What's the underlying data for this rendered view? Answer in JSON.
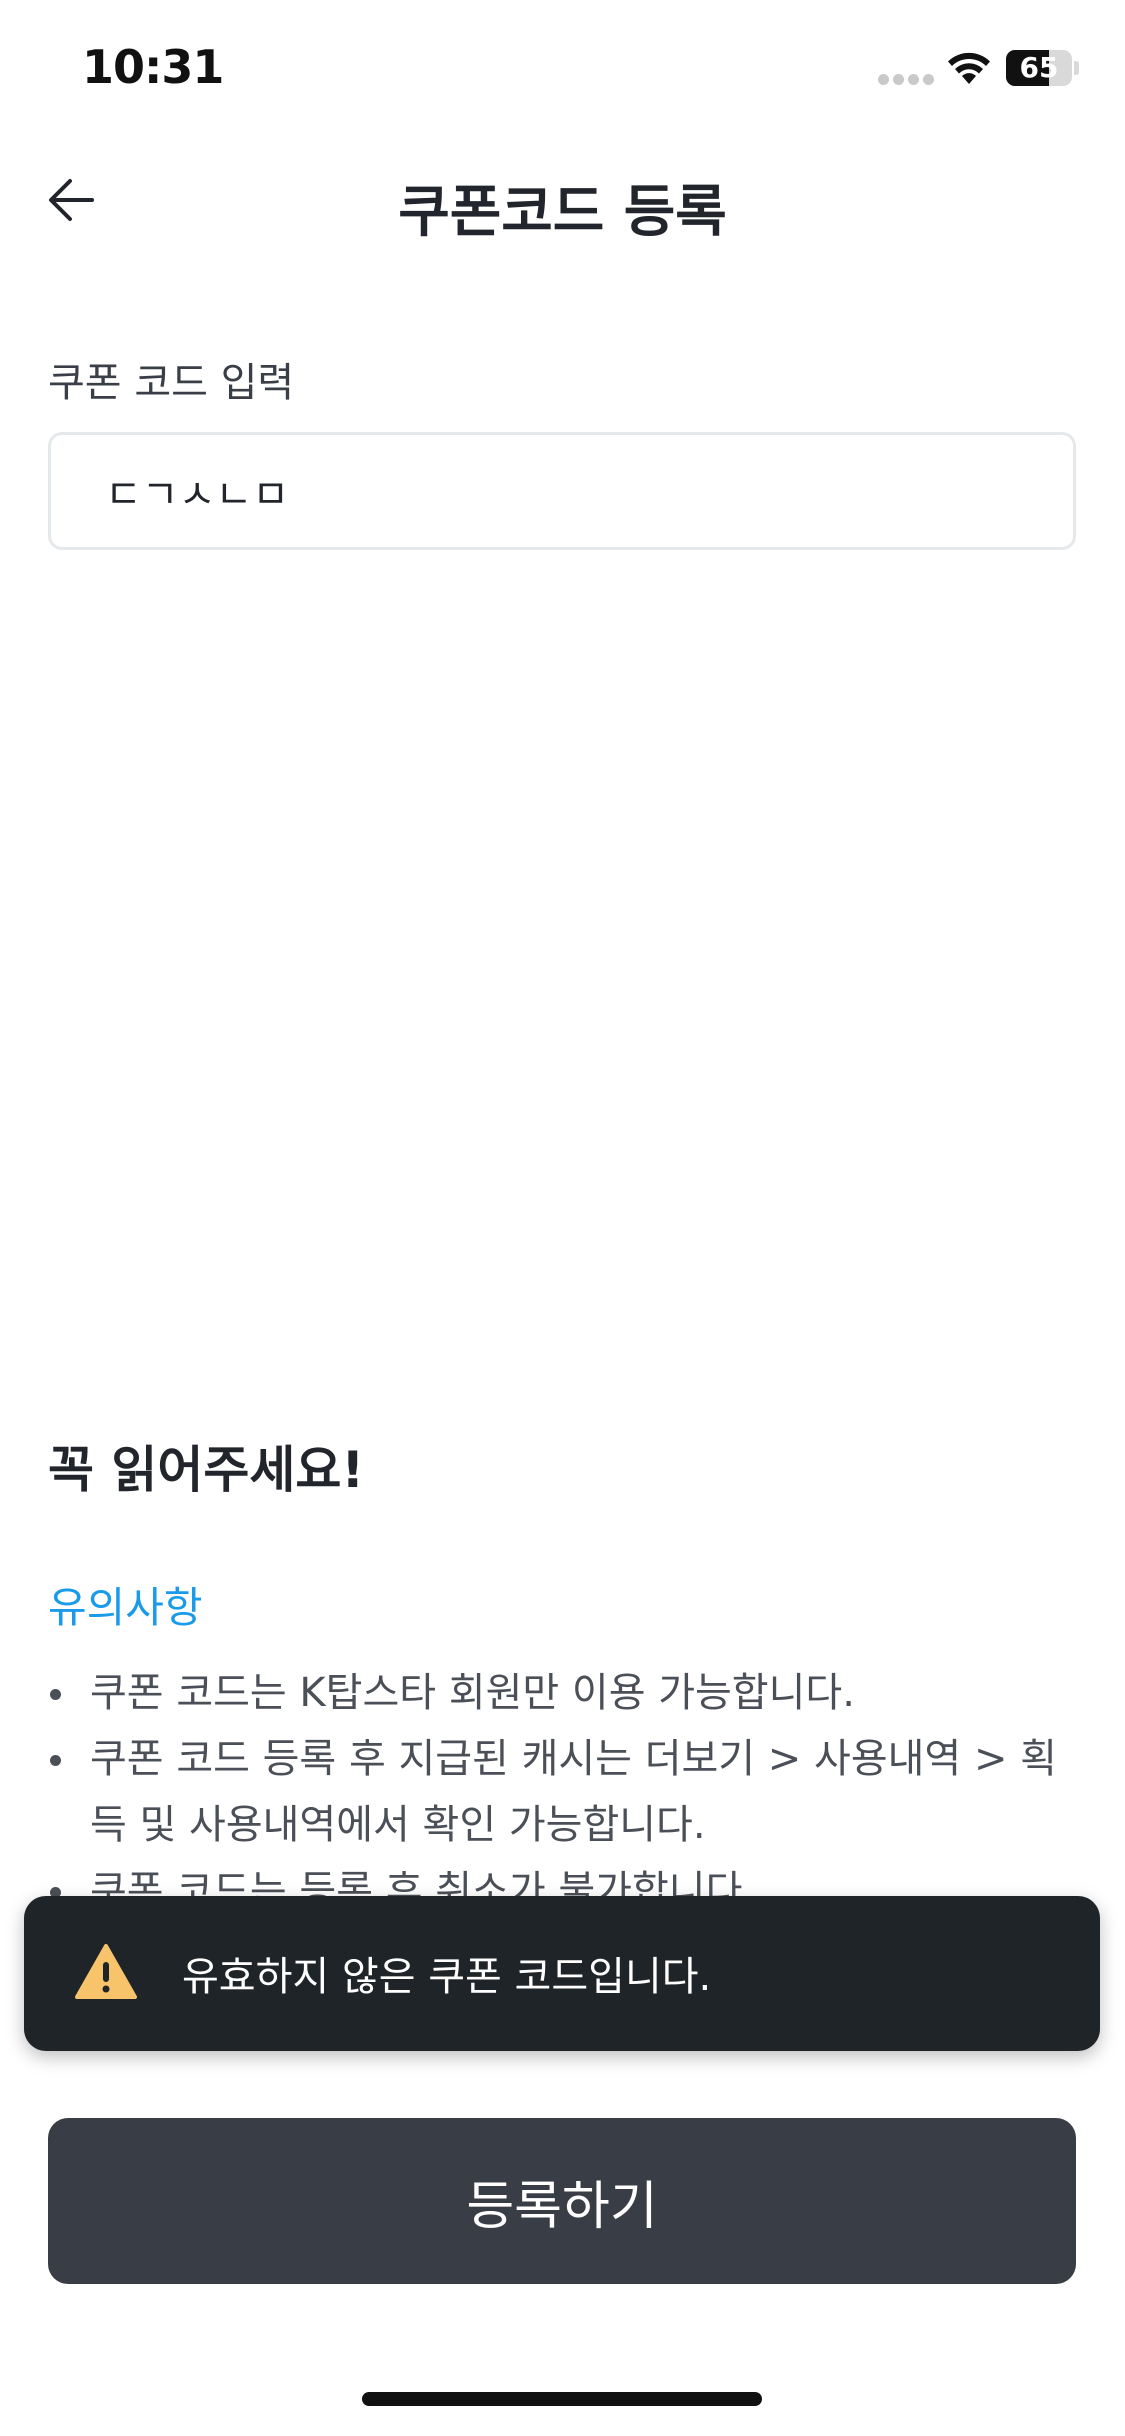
{
  "status_bar": {
    "time": "10:31",
    "battery_level": "65",
    "battery_fraction": 0.65,
    "icons": [
      "signal-dots-icon",
      "wifi-icon",
      "battery-icon"
    ]
  },
  "header": {
    "title": "쿠폰코드 등록",
    "back_icon": "arrow-left-icon"
  },
  "coupon_field": {
    "label": "쿠폰 코드 입력",
    "value": "ㄷㄱㅅㄴㅁ"
  },
  "notice": {
    "title": "꼭 읽어주세요!",
    "subtitle": "유의사항",
    "items": [
      "쿠폰 코드는 K탑스타 회원만 이용 가능합니다.",
      "쿠폰 코드 등록 후 지급된 캐시는 더보기 > 사용내역 > 획득 및 사용내역에서 확인 가능합니다.",
      "쿠폰 코드는 등록 후 취소가 불가합니다."
    ],
    "accent_color": "#1a9bea"
  },
  "toast": {
    "icon": "warning-icon",
    "message": "유효하지 않은 쿠폰 코드입니다.",
    "icon_color": "#f7c46c",
    "background": "#1f2429"
  },
  "register_button": {
    "label": "등록하기",
    "background": "#393e46"
  }
}
